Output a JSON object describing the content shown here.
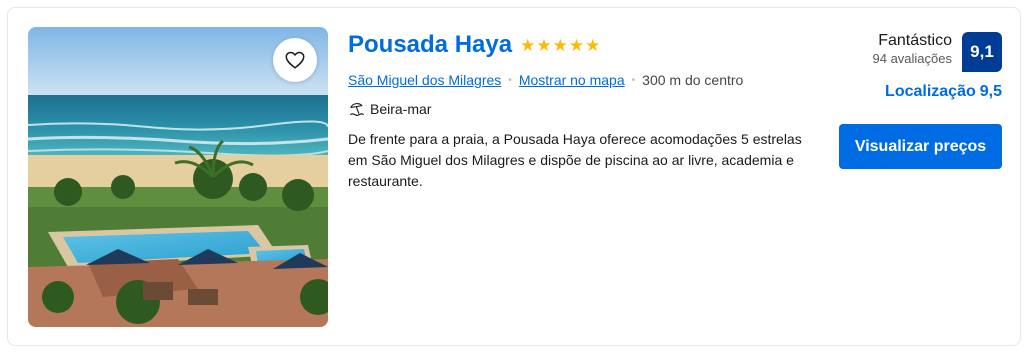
{
  "property": {
    "name": "Pousada Haya",
    "stars": 5,
    "location_link": "São Miguel dos Milagres",
    "map_link": "Mostrar no mapa",
    "distance": "300 m do centro",
    "feature": "Beira-mar",
    "description": "De frente para a praia, a Pousada Haya oferece acomodações 5 estrelas em São Miguel dos Milagres e dispõe de piscina ao ar livre, academia e restaurante."
  },
  "review": {
    "word": "Fantástico",
    "count": "94 avaliações",
    "score": "9,1",
    "location_label": "Localização",
    "location_score": "9,5"
  },
  "cta": {
    "label": "Visualizar preços"
  },
  "colors": {
    "link": "#006ce4",
    "score_bg": "#003b95",
    "star": "#febb02",
    "button": "#006ce4"
  },
  "icons": {
    "favorite": "heart-icon",
    "star": "star-icon",
    "beach": "beach-umbrella-icon"
  }
}
